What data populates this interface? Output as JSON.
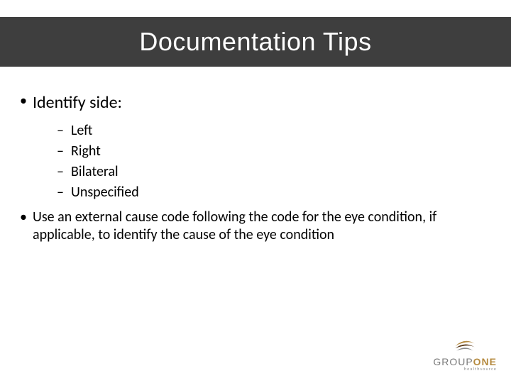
{
  "title": "Documentation Tips",
  "bullets": {
    "b1": "Identify side:",
    "sub": {
      "s1": "Left",
      "s2": "Right",
      "s3": "Bilateral",
      "s4": "Unspecified"
    },
    "b2": "Use an external cause code following the code for the eye condition, if applicable, to identify the cause of the eye condition"
  },
  "logo": {
    "group": "GROUP",
    "one": "ONE",
    "sub": "healthsource"
  }
}
